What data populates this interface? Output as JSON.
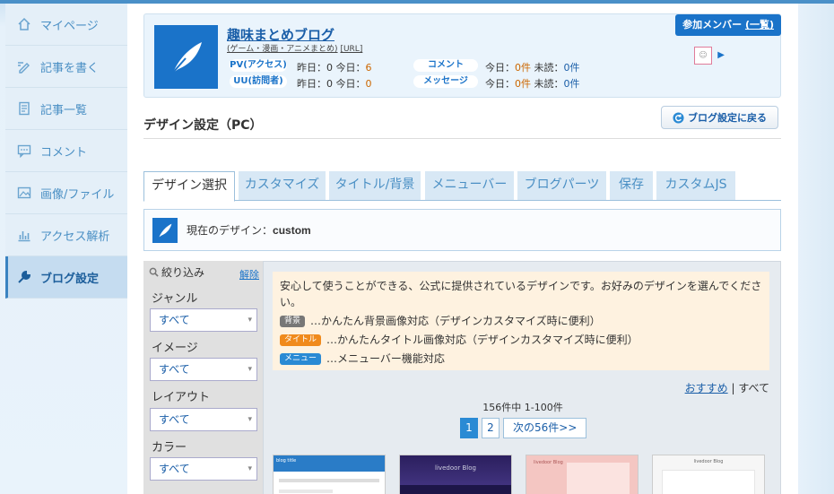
{
  "sidebar": {
    "items": [
      {
        "label": "マイページ",
        "icon": "home-icon"
      },
      {
        "label": "記事を書く",
        "icon": "pencil-icon"
      },
      {
        "label": "記事一覧",
        "icon": "document-icon"
      },
      {
        "label": "コメント",
        "icon": "comment-icon"
      },
      {
        "label": "画像/ファイル",
        "icon": "image-icon"
      },
      {
        "label": "アクセス解析",
        "icon": "chart-icon"
      },
      {
        "label": "ブログ設定",
        "icon": "wrench-icon"
      }
    ]
  },
  "header": {
    "title": "趣味まとめブログ",
    "category": "(ゲーム・漫画・アニメまとめ)",
    "url_label": "[URL]",
    "pv_label": "PV(アクセス)",
    "pv_values": {
      "yesterday_label": "昨日：",
      "yesterday": "0",
      "today_label": "今日：",
      "today": "6"
    },
    "uu_label": "UU(訪問者)",
    "uu_values": {
      "yesterday_label": "昨日：",
      "yesterday": "0",
      "today_label": "今日：",
      "today": "0"
    },
    "comment_label": "コメント",
    "comment_values": {
      "today_label": "今日：",
      "today": "0件",
      "unread_label": "未読：",
      "unread": "0件"
    },
    "message_label": "メッセージ",
    "message_values": {
      "today_label": "今日：",
      "today": "0件",
      "unread_label": "未読：",
      "unread": "0件"
    },
    "member_label": "参加メンバー",
    "member_link": "(一覧)"
  },
  "section_title": "デザイン設定（PC）",
  "back_button": "ブログ設定に戻る",
  "tabs": [
    "デザイン選択",
    "カスタマイズ",
    "タイトル/背景",
    "メニューバー",
    "ブログパーツ",
    "保存",
    "カスタムJS"
  ],
  "current_design": {
    "label": "現在のデザイン：",
    "value": "custom"
  },
  "filter": {
    "heading": "絞り込み",
    "reset": "解除",
    "groups": [
      {
        "label": "ジャンル",
        "value": "すべて"
      },
      {
        "label": "イメージ",
        "value": "すべて"
      },
      {
        "label": "レイアウト",
        "value": "すべて"
      },
      {
        "label": "カラー",
        "value": "すべて"
      }
    ]
  },
  "notice": {
    "text": "安心して使うことができる、公式に提供されているデザインです。お好みのデザインを選んでください。",
    "rows": [
      {
        "badge": "背景",
        "color": "#777777",
        "text": "…かんたん背景画像対応（デザインカスタマイズ時に便利）"
      },
      {
        "badge": "タイトル",
        "color": "#f08a1c",
        "text": "…かんたんタイトル画像対応（デザインカスタマイズ時に便利）"
      },
      {
        "badge": "メニュー",
        "color": "#2a8ad4",
        "text": "…メニューバー機能対応"
      }
    ]
  },
  "links": {
    "recommended": "おすすめ",
    "separator": "|",
    "all": "すべて"
  },
  "count_text": "156件中 1-100件",
  "pager": {
    "page1": "1",
    "page2": "2",
    "next": "次の56件>>"
  },
  "thumbnails": [
    {
      "title": "blog title"
    },
    {
      "title": "livedoor Blog"
    },
    {
      "title": "livedoor Blog"
    },
    {
      "title": "livedoor Blog"
    }
  ]
}
